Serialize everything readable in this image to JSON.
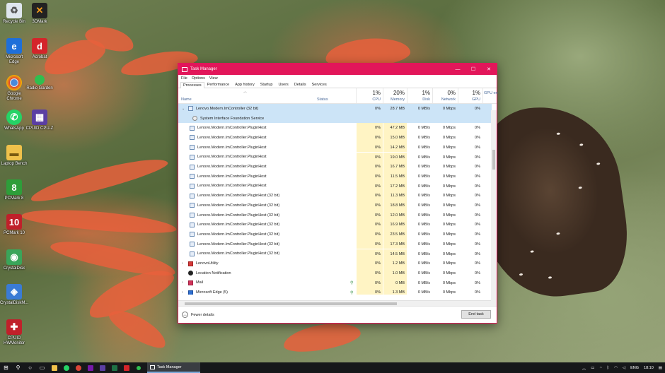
{
  "desktop": {
    "icons": [
      {
        "label": "Recycle Bin"
      },
      {
        "label": "3DMark"
      },
      {
        "label": "Microsoft Edge"
      },
      {
        "label": "Acrobat"
      },
      {
        "label": "Google Chrome"
      },
      {
        "label": "Radio Garden"
      },
      {
        "label": "WhatsApp"
      },
      {
        "label": "CPUID CPU-Z"
      },
      {
        "label": "Laptop Bench"
      },
      {
        "label": "PCMark 8"
      },
      {
        "label": "PCMark 10"
      },
      {
        "label": "CrystalDisk"
      },
      {
        "label": "CrystalDiskM..."
      },
      {
        "label": "CPUID HWMonitor"
      }
    ]
  },
  "window": {
    "title": "Task Manager",
    "minimize": "—",
    "maximize": "☐",
    "close": "✕",
    "menu": [
      "File",
      "Options",
      "View"
    ],
    "tabs": [
      "Processes",
      "Performance",
      "App history",
      "Startup",
      "Users",
      "Details",
      "Services"
    ],
    "active_tab": "Processes",
    "columns": {
      "name": "Name",
      "status": "Status",
      "cpu": {
        "pct": "1%",
        "label": "CPU"
      },
      "memory": {
        "pct": "20%",
        "label": "Memory"
      },
      "disk": {
        "pct": "1%",
        "label": "Disk"
      },
      "network": {
        "pct": "0%",
        "label": "Network"
      },
      "gpu": {
        "pct": "1%",
        "label": "GPU"
      },
      "gpu_engine": {
        "label": "GPU en"
      }
    },
    "rows": [
      {
        "name": "Lenovo.Modern.ImController (32 bit)",
        "cpu": "0%",
        "mem": "28.7 MB",
        "disk": "0 MB/s",
        "net": "0 Mbps",
        "gpu": "0%",
        "expand": "⌄",
        "selected": true,
        "icon": "app-icon",
        "indent": 0
      },
      {
        "name": "System Interface Foundation Service",
        "cpu": "",
        "mem": "",
        "disk": "",
        "net": "",
        "gpu": "",
        "selected": true,
        "icon": "gear-icon",
        "indent": 1
      },
      {
        "name": "Lenovo.Modern.ImController.PluginHost",
        "cpu": "0%",
        "mem": "47.2 MB",
        "disk": "0 MB/s",
        "net": "0 Mbps",
        "gpu": "0%",
        "icon": "app-icon",
        "indent": 1
      },
      {
        "name": "Lenovo.Modern.ImController.PluginHost",
        "cpu": "0%",
        "mem": "15.0 MB",
        "disk": "0 MB/s",
        "net": "0 Mbps",
        "gpu": "0%",
        "icon": "app-icon",
        "indent": 1
      },
      {
        "name": "Lenovo.Modern.ImController.PluginHost",
        "cpu": "0%",
        "mem": "14.2 MB",
        "disk": "0 MB/s",
        "net": "0 Mbps",
        "gpu": "0%",
        "icon": "app-icon",
        "indent": 1
      },
      {
        "name": "Lenovo.Modern.ImController.PluginHost",
        "cpu": "0%",
        "mem": "19.0 MB",
        "disk": "0 MB/s",
        "net": "0 Mbps",
        "gpu": "0%",
        "icon": "app-icon",
        "indent": 1
      },
      {
        "name": "Lenovo.Modern.ImController.PluginHost",
        "cpu": "0%",
        "mem": "16.7 MB",
        "disk": "0 MB/s",
        "net": "0 Mbps",
        "gpu": "0%",
        "icon": "app-icon",
        "indent": 1
      },
      {
        "name": "Lenovo.Modern.ImController.PluginHost",
        "cpu": "0%",
        "mem": "11.5 MB",
        "disk": "0 MB/s",
        "net": "0 Mbps",
        "gpu": "0%",
        "icon": "app-icon",
        "indent": 1
      },
      {
        "name": "Lenovo.Modern.ImController.PluginHost",
        "cpu": "0%",
        "mem": "17.2 MB",
        "disk": "0 MB/s",
        "net": "0 Mbps",
        "gpu": "0%",
        "icon": "app-icon",
        "indent": 1
      },
      {
        "name": "Lenovo.Modern.ImController.PluginHost (32 bit)",
        "cpu": "0%",
        "mem": "11.3 MB",
        "disk": "0 MB/s",
        "net": "0 Mbps",
        "gpu": "0%",
        "icon": "app-icon",
        "indent": 1
      },
      {
        "name": "Lenovo.Modern.ImController.PluginHost (32 bit)",
        "cpu": "0%",
        "mem": "18.8 MB",
        "disk": "0 MB/s",
        "net": "0 Mbps",
        "gpu": "0%",
        "icon": "app-icon",
        "indent": 1
      },
      {
        "name": "Lenovo.Modern.ImController.PluginHost (32 bit)",
        "cpu": "0%",
        "mem": "12.0 MB",
        "disk": "0 MB/s",
        "net": "0 Mbps",
        "gpu": "0%",
        "icon": "app-icon",
        "indent": 1
      },
      {
        "name": "Lenovo.Modern.ImController.PluginHost (32 bit)",
        "cpu": "0%",
        "mem": "16.9 MB",
        "disk": "0 MB/s",
        "net": "0 Mbps",
        "gpu": "0%",
        "icon": "app-icon",
        "indent": 1
      },
      {
        "name": "Lenovo.Modern.ImController.PluginHost (32 bit)",
        "cpu": "0%",
        "mem": "23.5 MB",
        "disk": "0 MB/s",
        "net": "0 Mbps",
        "gpu": "0%",
        "icon": "app-icon",
        "indent": 1
      },
      {
        "name": "Lenovo.Modern.ImController.PluginHost (32 bit)",
        "cpu": "0%",
        "mem": "17.3 MB",
        "disk": "0 MB/s",
        "net": "0 Mbps",
        "gpu": "0%",
        "icon": "app-icon",
        "indent": 1
      },
      {
        "name": "Lenovo.Modern.ImController.PluginHost (32 bit)",
        "cpu": "0%",
        "mem": "14.5 MB",
        "disk": "0 MB/s",
        "net": "0 Mbps",
        "gpu": "0%",
        "icon": "app-icon",
        "indent": 1
      },
      {
        "name": "LenovoUtility",
        "cpu": "0%",
        "mem": "1.2 MB",
        "disk": "0 MB/s",
        "net": "0 Mbps",
        "gpu": "0%",
        "expand": "›",
        "icon": "lenovo-icon",
        "indent": 0
      },
      {
        "name": "Location Notification",
        "cpu": "0%",
        "mem": "1.0 MB",
        "disk": "0 MB/s",
        "net": "0 Mbps",
        "gpu": "0%",
        "icon": "location-icon",
        "indent": 0
      },
      {
        "name": "Mail",
        "cpu": "0%",
        "mem": "0 MB",
        "disk": "0 MB/s",
        "net": "0 Mbps",
        "gpu": "0%",
        "expand": "›",
        "leaf": "⚲",
        "icon": "mail-icon",
        "indent": 0
      },
      {
        "name": "Microsoft Edge (5)",
        "cpu": "0%",
        "mem": "1.3 MB",
        "disk": "0 MB/s",
        "net": "0 Mbps",
        "gpu": "0%",
        "expand": "›",
        "leaf": "⚲",
        "icon": "edge-icon",
        "indent": 0
      }
    ],
    "footer": {
      "fewer_details": "Fewer details",
      "end_task": "End task"
    }
  },
  "taskbar": {
    "app_label": "Task Manager",
    "tray": {
      "lang": "ENG",
      "time": "18:10"
    }
  },
  "colors": {
    "accent": "#e2165a",
    "selection": "#cce4f7",
    "heat": "#fff4c4"
  }
}
